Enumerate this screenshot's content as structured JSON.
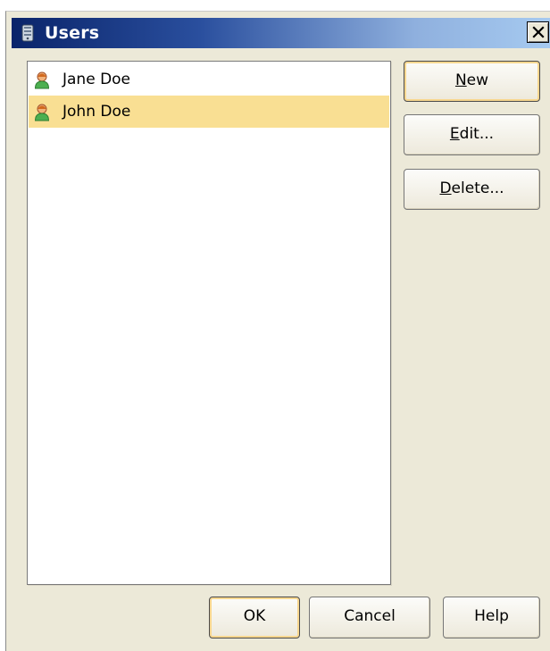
{
  "window": {
    "title": "Users",
    "title_icon": "users-database-icon",
    "close_icon": "close-icon"
  },
  "users_list": {
    "items": [
      {
        "label": "Jane Doe",
        "icon": "user-icon",
        "selected": false
      },
      {
        "label": "John Doe",
        "icon": "user-icon",
        "selected": true
      }
    ],
    "selection_color": "#f9df93"
  },
  "side_buttons": {
    "new": {
      "mnemonic": "N",
      "rest": "ew"
    },
    "edit": {
      "mnemonic": "E",
      "rest": "dit..."
    },
    "delete": {
      "mnemonic": "D",
      "rest": "elete..."
    }
  },
  "footer_buttons": {
    "ok": "OK",
    "cancel": "Cancel",
    "help": "Help"
  },
  "colors": {
    "titlebar_start": "#0a246a",
    "titlebar_end": "#a6caf0",
    "dialog_background": "#ece9d8"
  }
}
